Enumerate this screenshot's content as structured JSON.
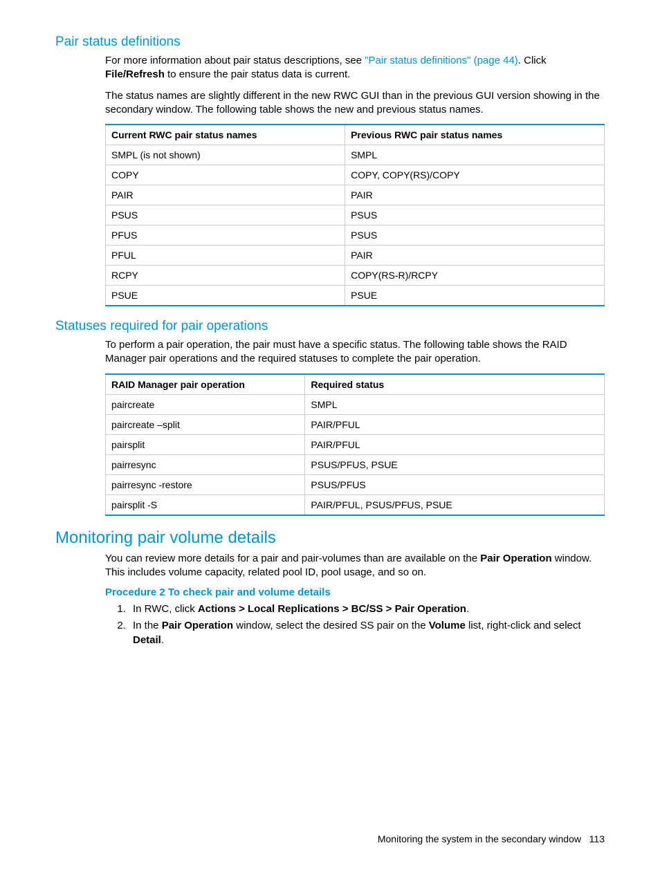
{
  "sec1": {
    "heading": "Pair status definitions",
    "p1a": "For more information about pair status descriptions, see ",
    "p1link": "\"Pair status definitions\" (page 44)",
    "p1b": ". Click ",
    "p1bold": "File/Refresh",
    "p1c": " to ensure the pair status data is current.",
    "p2": "The status names are slightly different in the new RWC GUI than in the previous GUI version showing in the secondary window. The following table shows the new and previous status names."
  },
  "table1": {
    "head": [
      "Current RWC pair status names",
      "Previous RWC pair status names"
    ],
    "rows": [
      [
        "SMPL (is not shown)",
        "SMPL"
      ],
      [
        "COPY",
        "COPY, COPY(RS)/COPY"
      ],
      [
        "PAIR",
        "PAIR"
      ],
      [
        "PSUS",
        "PSUS"
      ],
      [
        "PFUS",
        "PSUS"
      ],
      [
        "PFUL",
        "PAIR"
      ],
      [
        "RCPY",
        "COPY(RS-R)/RCPY"
      ],
      [
        "PSUE",
        "PSUE"
      ]
    ]
  },
  "sec2": {
    "heading": "Statuses required for pair operations",
    "p1": "To perform a pair operation, the pair must have a specific status. The following table shows the RAID Manager pair operations and the required statuses to complete the pair operation."
  },
  "table2": {
    "head": [
      "RAID Manager pair operation",
      "Required status"
    ],
    "rows": [
      [
        "paircreate",
        "SMPL"
      ],
      [
        "paircreate –split",
        "PAIR/PFUL"
      ],
      [
        "pairsplit",
        "PAIR/PFUL"
      ],
      [
        "pairresync",
        "PSUS/PFUS, PSUE"
      ],
      [
        "pairresync -restore",
        "PSUS/PFUS"
      ],
      [
        "pairsplit -S",
        "PAIR/PFUL, PSUS/PFUS, PSUE"
      ]
    ]
  },
  "sec3": {
    "heading": "Monitoring pair volume details",
    "p1a": "You can review more details for a pair and pair-volumes than are available on the ",
    "p1b1": "Pair Operation",
    "p1b": " window. This includes volume capacity, related pool ID, pool usage, and so on.",
    "proc": "Procedure 2 To check pair and volume details",
    "step1a": "In RWC, click ",
    "step1b": "Actions > Local Replications > BC/SS > Pair Operation",
    "step1c": ".",
    "step2a": "In the ",
    "step2b": "Pair Operation",
    "step2c": " window, select the desired SS pair on the ",
    "step2d": "Volume",
    "step2e": " list, right-click and select ",
    "step2f": "Detail",
    "step2g": "."
  },
  "footer": {
    "text": "Monitoring the system in the secondary window",
    "page": "113"
  }
}
